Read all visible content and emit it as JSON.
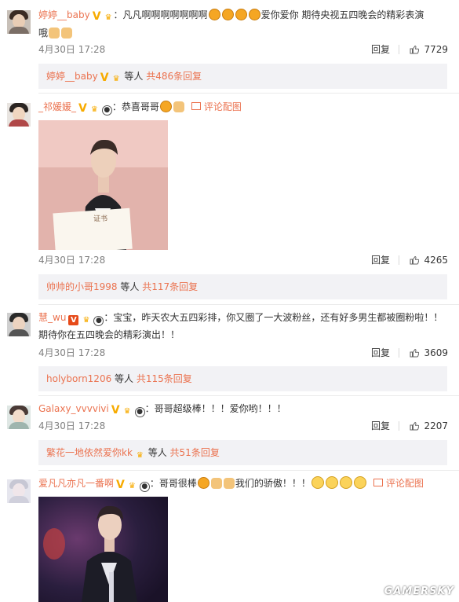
{
  "actions": {
    "reply": "回复",
    "pic_link": "评论配图"
  },
  "comments": [
    {
      "user": "婷婷__baby",
      "text_1": "：凡凡啊啊啊啊啊啊啊",
      "text_2": "爱你爱你 期待央视五四晚会的精彩表演",
      "text_3": "哦",
      "time": "4月30日 17:28",
      "likes": "7729",
      "reply_user": "婷婷__baby",
      "reply_mid": " 等人 ",
      "reply_count": "共486条回复"
    },
    {
      "user": "_祁媛媛_",
      "text_1": "：恭喜哥哥",
      "time": "4月30日 17:28",
      "likes": "4265",
      "reply_user": "帅帅的小哥1998",
      "reply_mid": " 等人 ",
      "reply_count": "共117条回复"
    },
    {
      "user": "慧_wu",
      "text_1": "：宝宝，昨天农大五四彩排，你又圈了一大波粉丝，还有好多男生都被圈粉啦！！",
      "text_2": "期待你在五四晚会的精彩演出！！",
      "time": "4月30日 17:28",
      "likes": "3609",
      "reply_user": "holyborn1206",
      "reply_mid": " 等人 ",
      "reply_count": "共115条回复"
    },
    {
      "user": "Galaxy_vvvvivi",
      "text_1": "：哥哥超级棒！！！爱你哟！！！",
      "time": "4月30日 17:28",
      "likes": "2207",
      "reply_user": "繁花一地依然爱你kk",
      "reply_mid": " 等人 ",
      "reply_count": "共51条回复"
    },
    {
      "user": "爱凡凡亦凡一番啊",
      "text_1": "：哥哥很棒",
      "text_2": "我们的骄傲！！！"
    }
  ],
  "photo_certificate_text": "证书",
  "watermark": "GAMERSKY",
  "colors": {
    "username": "#eb7350",
    "reply_bg": "#f2f2f5",
    "time": "#808080"
  }
}
